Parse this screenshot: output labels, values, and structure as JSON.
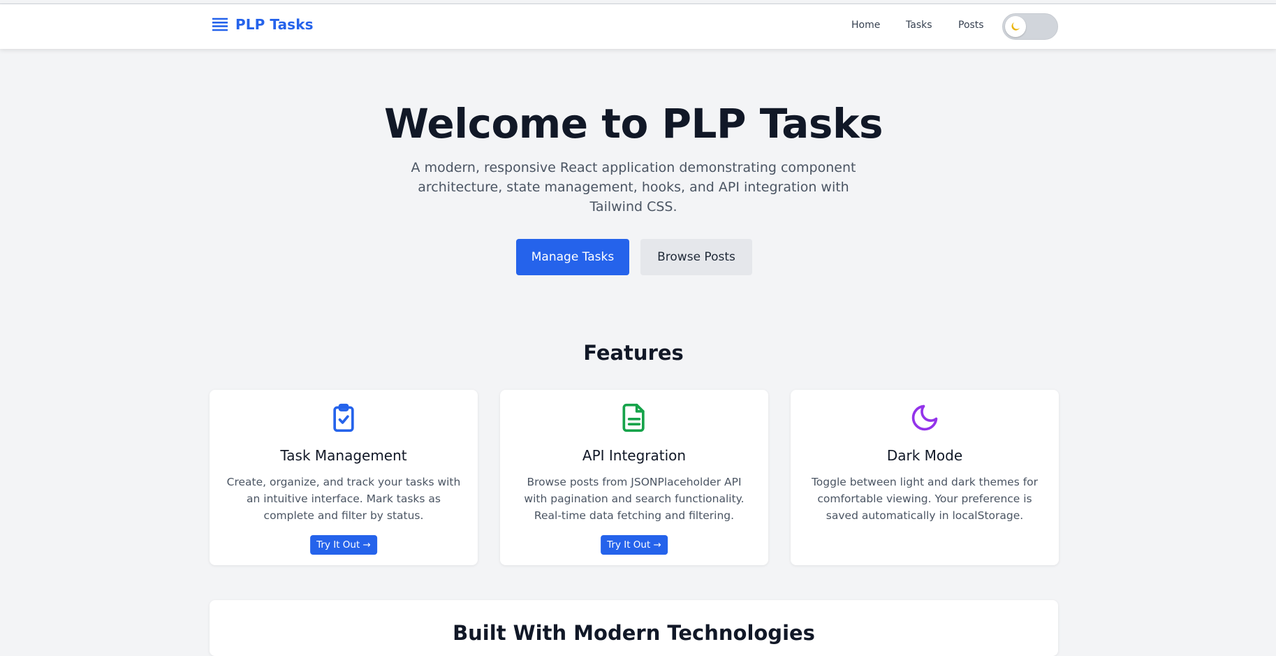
{
  "navbar": {
    "brand": "PLP Tasks",
    "links": [
      "Home",
      "Tasks",
      "Posts"
    ],
    "theme_toggle": {
      "state": "light",
      "icon": "moon-icon"
    }
  },
  "hero": {
    "title": "Welcome to PLP Tasks",
    "subtitle": "A modern, responsive React application demonstrating component architecture, state management, hooks, and API integration with Tailwind CSS.",
    "primary_button": "Manage Tasks",
    "secondary_button": "Browse Posts"
  },
  "features": {
    "title": "Features",
    "cards": [
      {
        "icon": "clipboard-check-icon",
        "icon_color": "#2563eb",
        "title": "Task Management",
        "description": "Create, organize, and track your tasks with an intuitive interface. Mark tasks as complete and filter by status.",
        "button": "Try It Out →"
      },
      {
        "icon": "document-icon",
        "icon_color": "#16a34a",
        "title": "API Integration",
        "description": "Browse posts from JSONPlaceholder API with pagination and search functionality. Real-time data fetching and filtering.",
        "button": "Try It Out →"
      },
      {
        "icon": "moon-icon",
        "icon_color": "#9333ea",
        "title": "Dark Mode",
        "description": "Toggle between light and dark themes for comfortable viewing. Your preference is saved automatically in localStorage."
      }
    ]
  },
  "tech": {
    "title": "Built With Modern Technologies"
  },
  "colors": {
    "accent": "#2563eb",
    "background": "#f3f4f6"
  }
}
